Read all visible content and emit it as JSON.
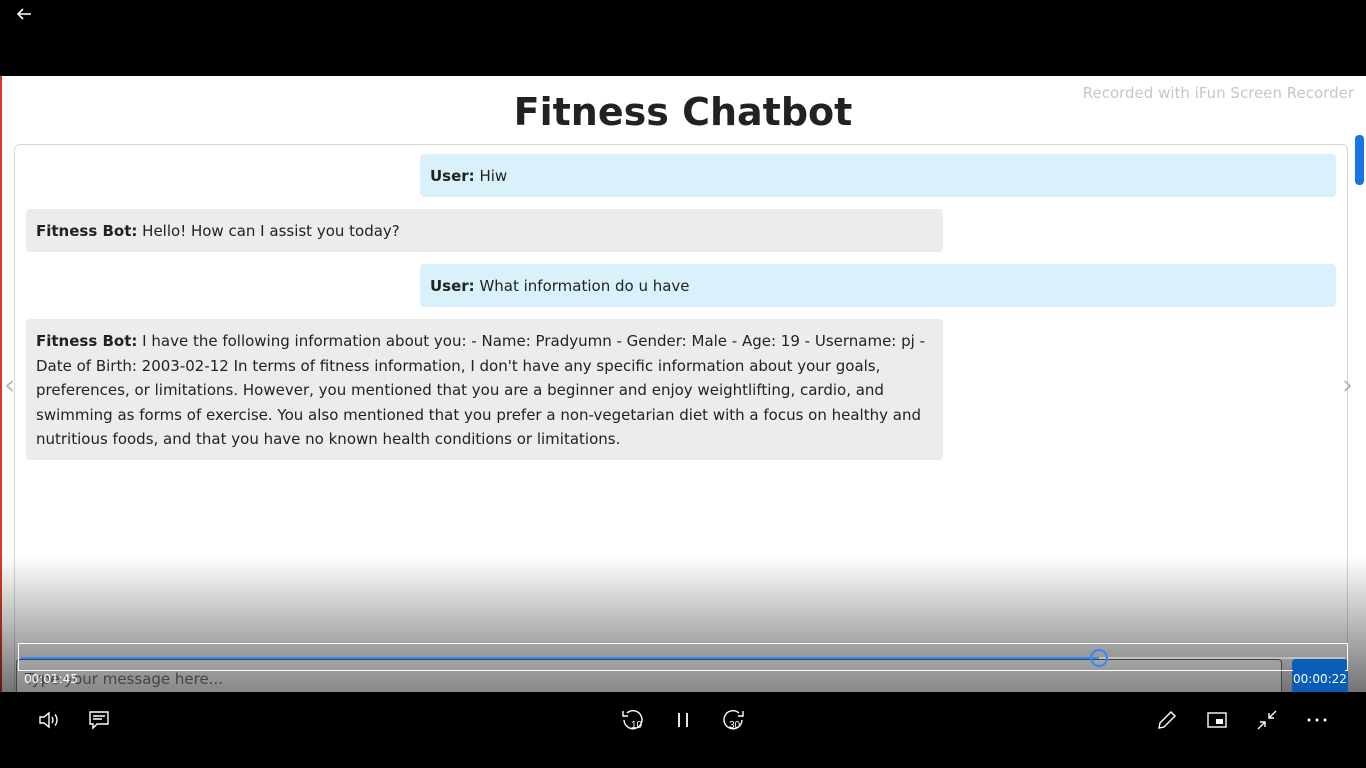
{
  "player": {
    "elapsed": "00:01:45",
    "remaining": "00:00:22",
    "progress_fraction": 0.814
  },
  "page": {
    "title": "Fitness Chatbot",
    "watermark": "Recorded with iFun Screen Recorder"
  },
  "messages": [
    {
      "role": "user",
      "speaker": "User:",
      "text": " Hiw"
    },
    {
      "role": "bot",
      "speaker": "Fitness Bot:",
      "text": " Hello! How can I assist you today?"
    },
    {
      "role": "user",
      "speaker": "User:",
      "text": " What information do u have"
    },
    {
      "role": "bot",
      "speaker": "Fitness Bot:",
      "text": " I have the following information about you: - Name: Pradyumn - Gender: Male - Age: 19 - Username: pj - Date of Birth: 2003-02-12 In terms of fitness information, I don't have any specific information about your goals, preferences, or limitations. However, you mentioned that you are a beginner and enjoy weightlifting, cardio, and swimming as forms of exercise. You also mentioned that you prefer a non-vegetarian diet with a focus on healthy and nutritious foods, and that you have no known health conditions or limitations."
    }
  ],
  "input": {
    "placeholder": "Type your message here..."
  },
  "icons": {
    "back": "back-arrow-icon",
    "volume": "volume-icon",
    "captions": "captions-icon",
    "skip_back": "skip-back-10-icon",
    "pause": "pause-icon",
    "skip_forward": "skip-forward-30-icon",
    "edit": "pen-icon",
    "mini_view": "mini-view-icon",
    "exit_fullscreen": "exit-fullscreen-icon",
    "more": "more-icon"
  },
  "skip": {
    "back_seconds": "10",
    "forward_seconds": "30"
  }
}
